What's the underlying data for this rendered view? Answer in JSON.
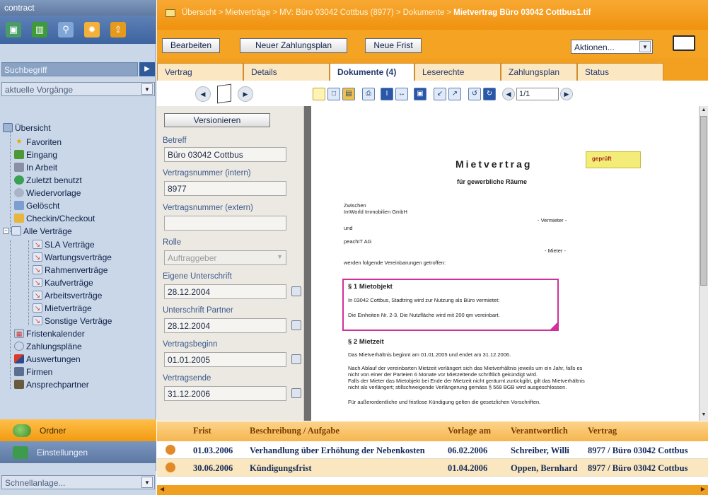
{
  "app": {
    "title": "contract"
  },
  "sidebar": {
    "toolbar_icons": [
      "new-contract-icon",
      "book-icon",
      "search-tool-icon",
      "settings-gear-icon",
      "upload-icon"
    ],
    "search": {
      "placeholder": "Suchbegriff",
      "go_icon": "play-arrow-icon"
    },
    "filter": {
      "value": "aktuelle Vorgänge"
    },
    "tree": {
      "root": "Übersicht",
      "items": [
        {
          "label": "Favoriten",
          "icon": "star-icon"
        },
        {
          "label": "Eingang",
          "icon": "inbox-icon"
        },
        {
          "label": "In Arbeit",
          "icon": "work-icon"
        },
        {
          "label": "Zuletzt benutzt",
          "icon": "recent-icon"
        },
        {
          "label": "Wiedervorlage",
          "icon": "resubmission-icon"
        },
        {
          "label": "Gelöscht",
          "icon": "trash-icon"
        },
        {
          "label": "Checkin/Checkout",
          "icon": "lock-icon"
        }
      ],
      "all_contracts": "Alle Verträge",
      "contract_types": [
        "SLA Verträge",
        "Wartungsverträge",
        "Rahmenverträge",
        "Kaufverträge",
        "Arbeitsverträge",
        "Mietverträge",
        "Sonstige Verträge"
      ],
      "bottom_items": [
        {
          "label": "Fristenkalender",
          "icon": "calendar-icon"
        },
        {
          "label": "Zahlungspläne",
          "icon": "payment-icon"
        },
        {
          "label": "Auswertungen",
          "icon": "chart-icon"
        },
        {
          "label": "Firmen",
          "icon": "company-icon"
        },
        {
          "label": "Ansprechpartner",
          "icon": "contact-icon"
        }
      ]
    },
    "panels": {
      "ordner": "Ordner",
      "einstellungen": "Einstellungen"
    },
    "quick": {
      "value": "Schnellanlage..."
    }
  },
  "breadcrumb": {
    "items": [
      "Übersicht",
      "Mietverträge",
      "MV: Büro 03042 Cottbus (8977)",
      "Dokumente"
    ],
    "separator": ">",
    "current": "Mietvertrag Büro 03042 Cottbus1.tif"
  },
  "actions": {
    "edit": "Bearbeiten",
    "new_payment_plan": "Neuer Zahlungsplan",
    "new_deadline": "Neue Frist",
    "actions_select": "Aktionen..."
  },
  "tabs": [
    "Vertrag",
    "Details",
    "Dokumente (4)",
    "Leserechte",
    "Zahlungsplan",
    "Status"
  ],
  "viewer_toolbar": {
    "page": "1/1"
  },
  "form": {
    "versionieren": "Versionieren",
    "fields": [
      {
        "label": "Betreff",
        "value": "Büro 03042 Cottbus"
      },
      {
        "label": "Vertragsnummer (intern)",
        "value": "8977"
      },
      {
        "label": "Vertragsnummer (extern)",
        "value": ""
      },
      {
        "label": "Rolle",
        "value": "Auftraggeber"
      },
      {
        "label": "Eigene Unterschrift",
        "value": "28.12.2004"
      },
      {
        "label": "Unterschrift Partner",
        "value": "28.12.2004"
      },
      {
        "label": "Vertragsbeginn",
        "value": "01.01.2005"
      },
      {
        "label": "Vertragsende",
        "value": "31.12.2006"
      }
    ]
  },
  "document": {
    "title": "Mietvertrag",
    "subtitle": "für gewerbliche Räume",
    "note": "geprüft",
    "zwischen": "Zwischen",
    "landlord": "ImWorld Immobilien GmbH",
    "landlord_role": "- Vermieter -",
    "und": "und",
    "tenant": "peachIT AG",
    "tenant_role": "- Mieter -",
    "agreements": "werden folgende Vereinbarungen getroffen:",
    "s1_title": "§ 1 Mietobjekt",
    "s1_line1": "In 03042 Cottbus, Stadtring wird zur Nutzung als Büro vermietet:",
    "s1_line2": "Die Einheiten Nr. 2-3. Die Nutzfläche wird mit 200 qm vereinbart.",
    "s2_title": "§ 2 Mietzeit",
    "s2_p1": "Das Mietverhältnis beginnt am 01.01.2005 und endet am 31.12.2006.",
    "s2_p2a": "Nach Ablauf der vereinbarten Mietzeit verlängert sich das Mietverhältnis jeweils um ein Jahr, falls es",
    "s2_p2b": "nicht von einer der Parteien 6 Monate vor Mietzeitende schriftlich gekündigt wird.",
    "s2_p2c": "Falls der Mieter das Mietobjekt bei Ende der Mietzeit nicht geräumt zurückgibt, gilt das Mietverhältnis",
    "s2_p2d": "nicht als verlängert; stillschweigende Verlängerung gemäss § 568 BGB wird ausgeschlossen.",
    "s2_p3": "Für außerordentliche und fristlose Kündigung gelten die gesetzlichen Vorschriften."
  },
  "deadlines": {
    "columns": [
      "Frist",
      "Beschreibung / Aufgabe",
      "Vorlage am",
      "Verantwortlich",
      "Vertrag"
    ],
    "rows": [
      {
        "frist": "01.03.2006",
        "beschreibung": "Verhandlung über Erhöhung der Nebenkosten",
        "vorlage": "06.02.2006",
        "verantwortlich": "Schreiber, Willi",
        "vertrag": "8977 / Büro 03042 Cottbus"
      },
      {
        "frist": "30.06.2006",
        "beschreibung": "Kündigungsfrist",
        "vorlage": "01.04.2006",
        "verantwortlich": "Oppen, Bernhard",
        "vertrag": "8977 / Büro 03042 Cottbus"
      }
    ]
  },
  "colors": {
    "orange_accent": "#f3a021",
    "sidebar_bg": "#c9d7e8",
    "highlight_box": "#d0309a",
    "note_yellow": "#f4ec78"
  }
}
